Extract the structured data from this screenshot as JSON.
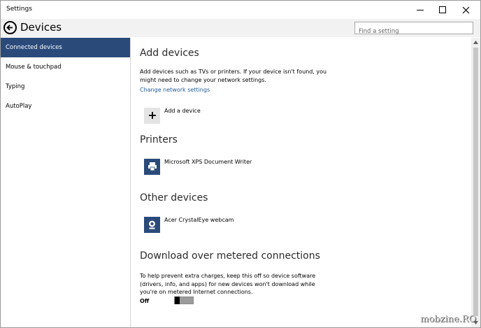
{
  "window": {
    "title": "Settings"
  },
  "header": {
    "title": "Devices",
    "search_placeholder": "Find a setting"
  },
  "sidebar": {
    "items": [
      {
        "label": "Connected devices",
        "selected": true
      },
      {
        "label": "Mouse & touchpad",
        "selected": false
      },
      {
        "label": "Typing",
        "selected": false
      },
      {
        "label": "AutoPlay",
        "selected": false
      }
    ]
  },
  "content": {
    "add_devices": {
      "heading": "Add devices",
      "description": "Add devices such as TVs or printers. If your device isn't found, you might need to change your network settings.",
      "link": "Change network settings",
      "add_button": "Add a device"
    },
    "printers": {
      "heading": "Printers",
      "items": [
        {
          "label": "Microsoft XPS Document Writer",
          "icon": "printer-icon"
        }
      ]
    },
    "other_devices": {
      "heading": "Other devices",
      "items": [
        {
          "label": "Acer CrystalEye webcam",
          "icon": "webcam-icon"
        }
      ]
    },
    "metered": {
      "heading": "Download over metered connections",
      "description": "To help prevent extra charges, keep this off so device software (drivers, info, and apps) for new devices won't download while you're on metered Internet connections.",
      "toggle_label": "Off",
      "toggle_on": false
    }
  },
  "watermark": "mobzine.RO",
  "colors": {
    "accent": "#2a4a7a",
    "link": "#1e5a9a",
    "header_bg": "#f2f2f2"
  }
}
